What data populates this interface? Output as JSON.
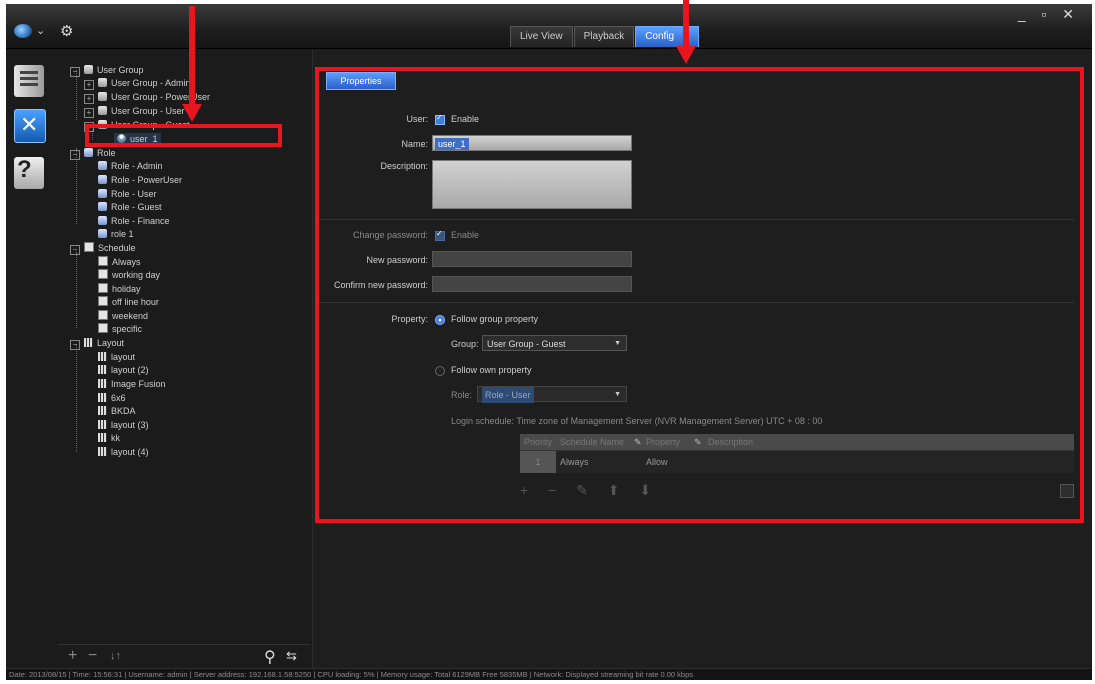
{
  "titlebar": {
    "tabs": [
      {
        "label": "Live View"
      },
      {
        "label": "Playback"
      },
      {
        "label": "Config"
      }
    ],
    "window_buttons": "_ ▫ ✕"
  },
  "tree": {
    "nodes": [
      {
        "label": "User Group",
        "icon": "group-icon"
      },
      {
        "label": "User Group - Admin",
        "icon": "group-icon"
      },
      {
        "label": "User Group - PowerUser",
        "icon": "group-icon"
      },
      {
        "label": "User Group - User",
        "icon": "group-icon"
      },
      {
        "label": "User Group - Guest",
        "icon": "group-icon"
      },
      {
        "label": "user_1",
        "icon": "user-icon"
      },
      {
        "label": "Role",
        "icon": "role-icon"
      },
      {
        "label": "Role - Admin",
        "icon": "role-icon"
      },
      {
        "label": "Role - PowerUser",
        "icon": "role-icon"
      },
      {
        "label": "Role - User",
        "icon": "role-icon"
      },
      {
        "label": "Role - Guest",
        "icon": "role-icon"
      },
      {
        "label": "Role - Finance",
        "icon": "role-icon"
      },
      {
        "label": "role 1",
        "icon": "role-icon"
      },
      {
        "label": "Schedule",
        "icon": "schedule-icon"
      },
      {
        "label": "Always",
        "icon": "schedule-icon"
      },
      {
        "label": "working day",
        "icon": "schedule-icon"
      },
      {
        "label": "holiday",
        "icon": "schedule-icon"
      },
      {
        "label": "off line hour",
        "icon": "schedule-icon"
      },
      {
        "label": "weekend",
        "icon": "schedule-icon"
      },
      {
        "label": "specific",
        "icon": "schedule-icon"
      },
      {
        "label": "Layout",
        "icon": "layout-icon"
      },
      {
        "label": "layout",
        "icon": "layout-icon"
      },
      {
        "label": "layout (2)",
        "icon": "layout-icon"
      },
      {
        "label": "Image Fusion",
        "icon": "layout-icon"
      },
      {
        "label": "6x6",
        "icon": "layout-icon"
      },
      {
        "label": "BKDA",
        "icon": "layout-icon"
      },
      {
        "label": "layout (3)",
        "icon": "layout-icon"
      },
      {
        "label": "kk",
        "icon": "layout-icon"
      },
      {
        "label": "layout (4)",
        "icon": "layout-icon"
      }
    ],
    "tools": {
      "add": "+",
      "remove": "−",
      "sort": "↓↑"
    }
  },
  "properties": {
    "tab_label": "Properties",
    "user_label": "User:",
    "enable_label": "Enable",
    "name_label": "Name:",
    "name_value": "user_1",
    "description_label": "Description:",
    "change_password_label": "Change password:",
    "change_password_enable": "Enable",
    "new_password_label": "New password:",
    "confirm_password_label": "Confirm new password:",
    "property_label": "Property:",
    "follow_group": "Follow group property",
    "group_label": "Group:",
    "group_value": "User Group - Guest",
    "follow_own": "Follow own property",
    "role_label": "Role:",
    "role_value": "Role - User",
    "login_schedule": "Login schedule:  Time zone of Management Server (NVR Management Server) UTC + 08 : 00",
    "table": {
      "headers": [
        "Priority",
        "Schedule Name",
        "Property",
        "Description"
      ],
      "rows": [
        [
          "1",
          "Always",
          "Allow",
          ""
        ]
      ]
    },
    "table_tools": "+ − ✎ ⬆ ⬇"
  },
  "status_bar": "Date: 2013/08/15  |  Time: 15:56:31  |  Username: admin  |  Server address: 192.168.1.58:5250  |  CPU loading: 5%  |  Memory usage: Total 6129MB Free 5835MB  |  Network: Displayed streaming bit rate    0.00 kbps",
  "colors": {
    "accent": "#3c7be0",
    "annotation": "#e8141e",
    "background": "#1b1b1b"
  }
}
